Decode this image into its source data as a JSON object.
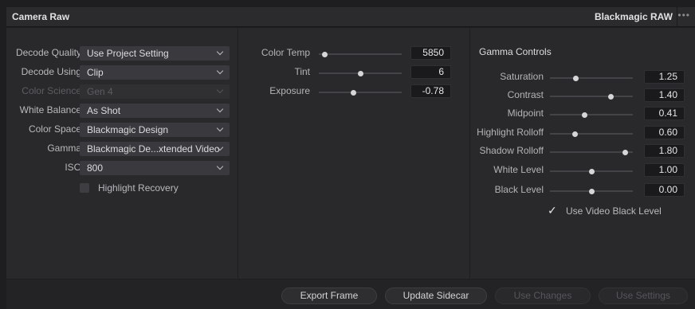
{
  "header": {
    "title": "Camera Raw",
    "format": "Blackmagic RAW",
    "more_icon": "ellipsis-icon"
  },
  "left": {
    "rows": [
      {
        "label": "Decode Quality",
        "value": "Use Project Setting",
        "enabled": true
      },
      {
        "label": "Decode Using",
        "value": "Clip",
        "enabled": true
      },
      {
        "label": "Color Science",
        "value": "Gen 4",
        "enabled": false
      },
      {
        "label": "White Balance",
        "value": "As Shot",
        "enabled": true
      },
      {
        "label": "Color Space",
        "value": "Blackmagic Design",
        "enabled": true
      },
      {
        "label": "Gamma",
        "value": "Blackmagic De...xtended Video",
        "enabled": true
      },
      {
        "label": "ISO",
        "value": "800",
        "enabled": true
      }
    ],
    "highlight_recovery": {
      "label": "Highlight Recovery",
      "checked": false
    }
  },
  "middle": {
    "sliders": [
      {
        "label": "Color Temp",
        "value": "5850",
        "position": 0.07
      },
      {
        "label": "Tint",
        "value": "6",
        "position": 0.5
      },
      {
        "label": "Exposure",
        "value": "-0.78",
        "position": 0.41
      }
    ]
  },
  "gamma": {
    "title": "Gamma Controls",
    "sliders": [
      {
        "label": "Saturation",
        "value": "1.25",
        "position": 0.31
      },
      {
        "label": "Contrast",
        "value": "1.40",
        "position": 0.73
      },
      {
        "label": "Midpoint",
        "value": "0.41",
        "position": 0.41
      },
      {
        "label": "Highlight Rolloff",
        "value": "0.60",
        "position": 0.3
      },
      {
        "label": "Shadow Rolloff",
        "value": "1.80",
        "position": 0.9
      },
      {
        "label": "White Level",
        "value": "1.00",
        "position": 0.5
      },
      {
        "label": "Black Level",
        "value": "0.00",
        "position": 0.5
      }
    ],
    "use_video_black_level": {
      "label": "Use Video Black Level",
      "checked": true
    }
  },
  "footer": {
    "buttons": [
      {
        "label": "Export Frame",
        "enabled": true
      },
      {
        "label": "Update Sidecar",
        "enabled": true
      },
      {
        "label": "Use Changes",
        "enabled": false
      },
      {
        "label": "Use Settings",
        "enabled": false
      }
    ]
  }
}
